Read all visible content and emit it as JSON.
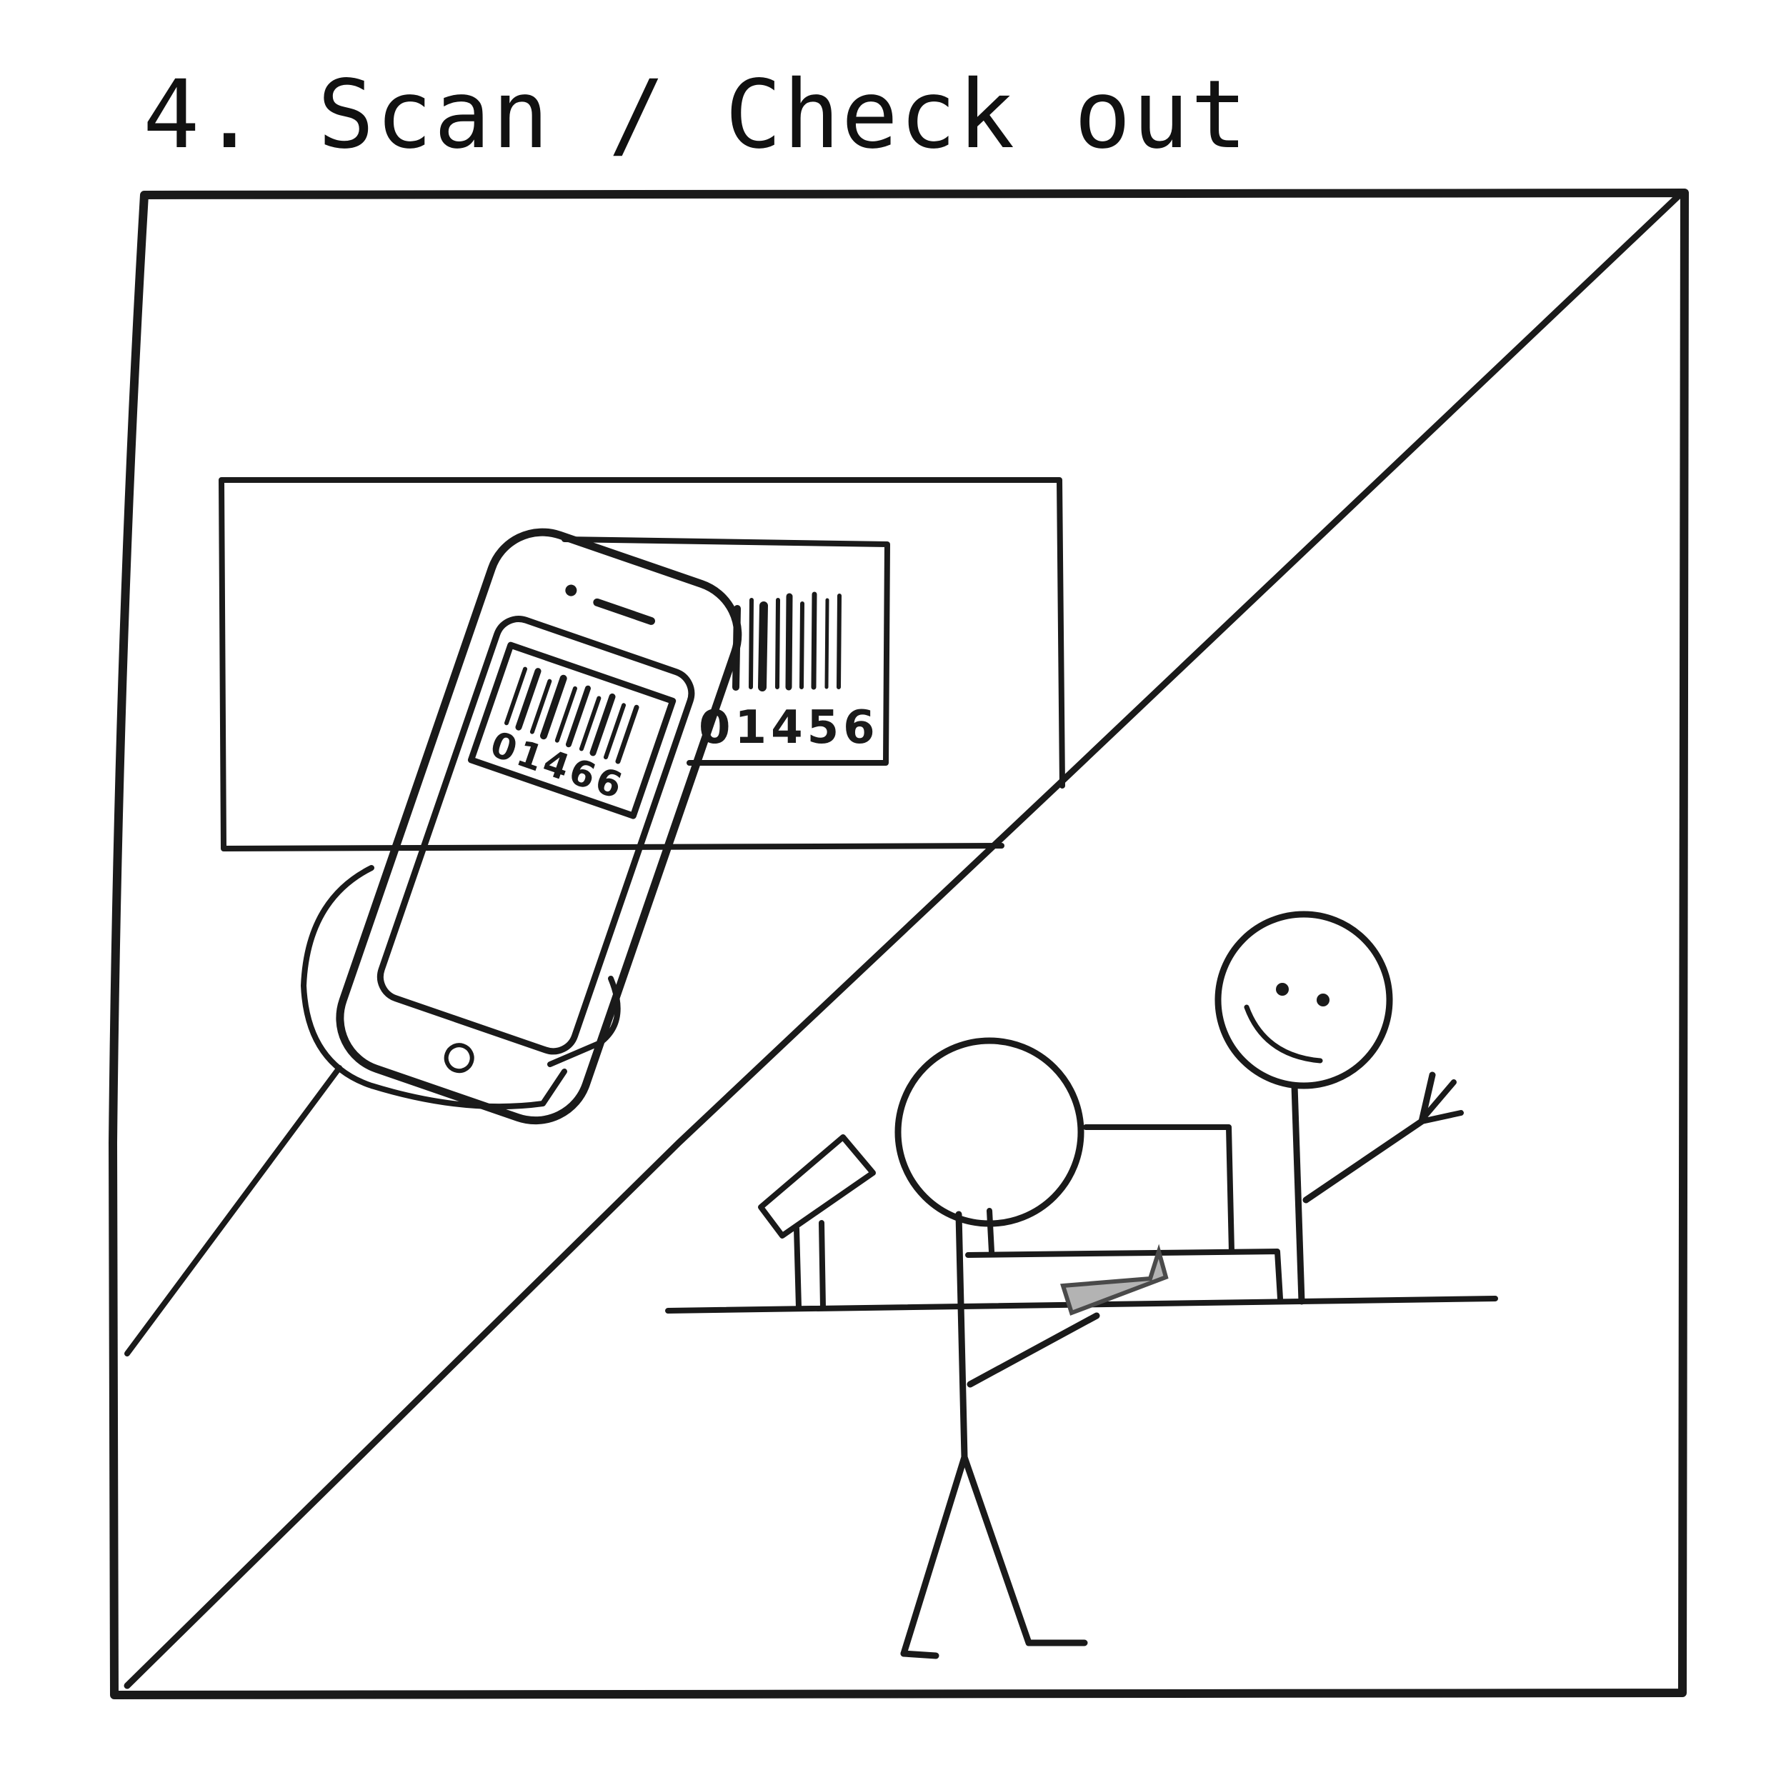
{
  "title": "4. Scan / Check out",
  "product_label": {
    "barcode_number": "01456"
  },
  "phone_screen": {
    "barcode_number": "01466"
  },
  "colors": {
    "ink": "#1a1a1a",
    "paper": "#ffffff",
    "card": "#b3b3b3"
  }
}
